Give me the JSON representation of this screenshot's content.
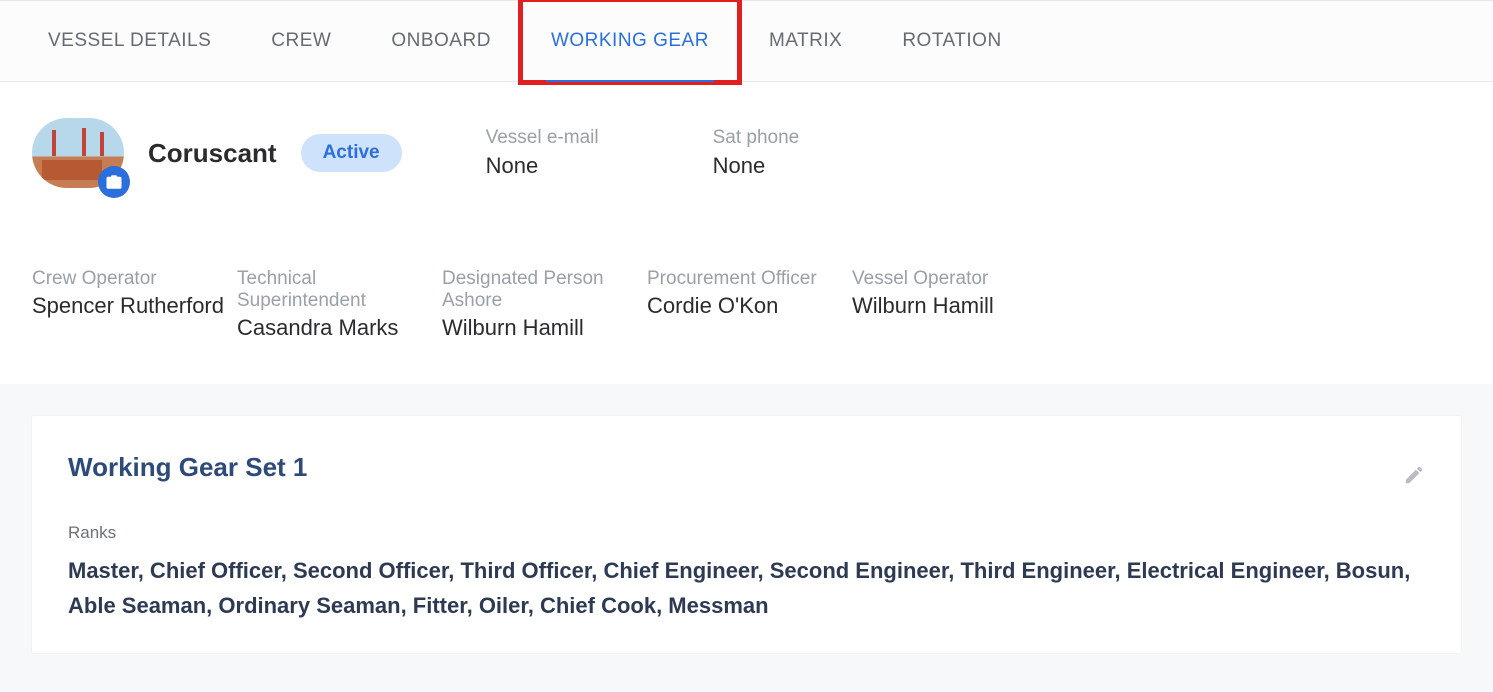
{
  "tabs": [
    {
      "label": "VESSEL DETAILS"
    },
    {
      "label": "CREW"
    },
    {
      "label": "ONBOARD"
    },
    {
      "label": "WORKING GEAR"
    },
    {
      "label": "MATRIX"
    },
    {
      "label": "ROTATION"
    }
  ],
  "vessel": {
    "name": "Coruscant",
    "status": "Active",
    "email_label": "Vessel e-mail",
    "email_value": "None",
    "sat_label": "Sat phone",
    "sat_value": "None"
  },
  "roles": [
    {
      "label": "Crew Operator",
      "value": "Spencer Rutherford"
    },
    {
      "label": "Technical Superintendent",
      "value": "Casandra Marks"
    },
    {
      "label": "Designated Person Ashore",
      "value": "Wilburn Hamill"
    },
    {
      "label": "Procurement Officer",
      "value": "Cordie O'Kon"
    },
    {
      "label": "Vessel Operator",
      "value": "Wilburn Hamill"
    }
  ],
  "gearSet": {
    "title": "Working Gear Set 1",
    "ranks_label": "Ranks",
    "ranks": "Master, Chief Officer, Second Officer, Third Officer, Chief Engineer, Second Engineer, Third Engineer, Electrical Engineer, Bosun, Able Seaman, Ordinary Seaman, Fitter, Oiler, Chief Cook, Messman"
  }
}
